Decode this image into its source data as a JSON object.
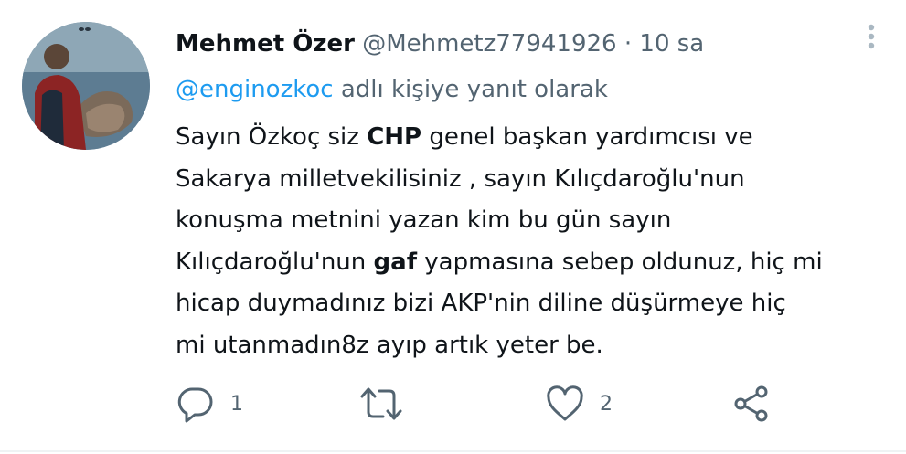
{
  "tweet": {
    "author_name": "Mehmet Özer",
    "handle": "@Mehmetz77941926",
    "separator": "·",
    "time": "10 sa",
    "reply_to_handle": "@enginozkoc",
    "reply_to_suffix": "adlı kişiye yanıt olarak",
    "text_lines": [
      [
        "Sayın Özkoç siz ",
        "CHP",
        " genel başkan yardımcısı ve"
      ],
      "Sakarya milletvekilisiniz , sayın Kılıçdaroğlu'nun",
      "konuşma metnini yazan kim bu gün sayın",
      [
        "Kılıçdaroğlu'nun ",
        "gaf",
        " yapmasına sebep oldunuz, hiç mi"
      ],
      "hicap duymadınız bizi AKP'nin diline düşürmeye hiç",
      "mi utanmadın8z ayıp artık yeter be."
    ],
    "reply_count": "1",
    "retweet_count": "",
    "like_count": "2"
  },
  "icons": {
    "more": "more-vertical-icon",
    "reply": "reply-bubble-icon",
    "retweet": "retweet-icon",
    "like": "heart-icon",
    "share": "share-icon"
  },
  "colors": {
    "text": "#0f1419",
    "muted": "#536471",
    "link": "#1d9bf0",
    "divider": "#eff3f4"
  }
}
